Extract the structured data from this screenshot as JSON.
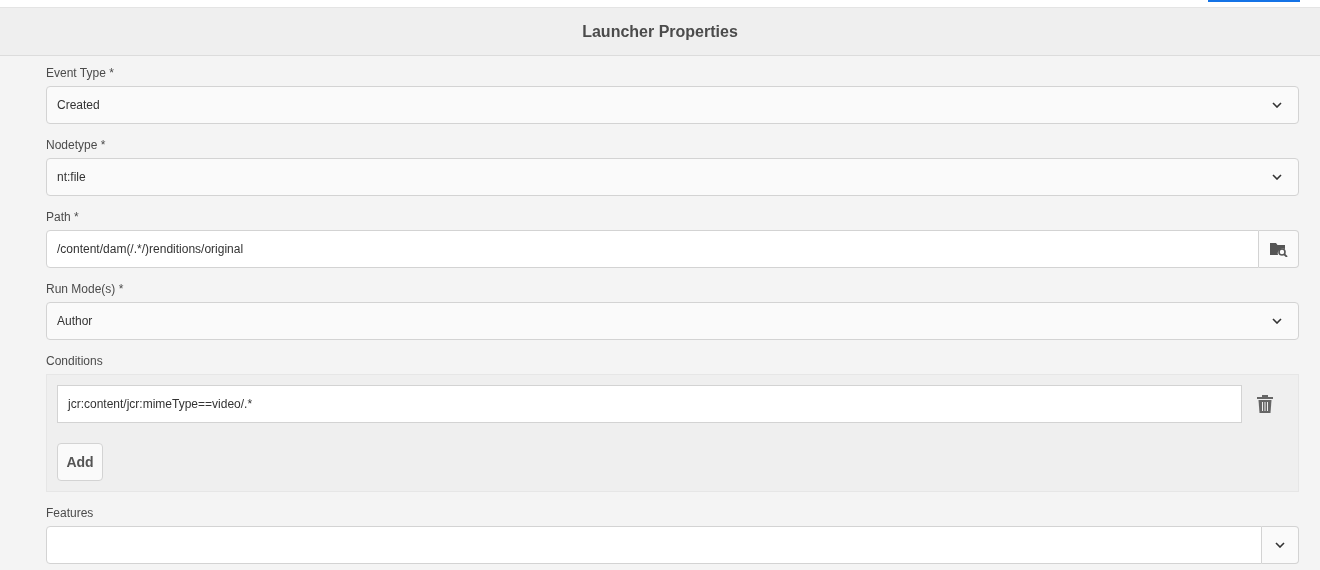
{
  "header": {
    "title": "Launcher Properties"
  },
  "fields": [
    {
      "kind": "select",
      "label": "Event Type *",
      "value": "Created"
    },
    {
      "kind": "select",
      "label": "Nodetype *",
      "value": "nt:file"
    },
    {
      "kind": "path",
      "label": "Path *",
      "value": "/content/dam(/.*/)renditions/original"
    },
    {
      "kind": "select",
      "label": "Run Mode(s) *",
      "value": "Author"
    },
    {
      "kind": "multifield",
      "label": "Conditions",
      "items": [
        "jcr:content/jcr:mimeType==video/.*"
      ],
      "add_button": "Add"
    },
    {
      "kind": "combobox",
      "label": "Features"
    }
  ]
}
